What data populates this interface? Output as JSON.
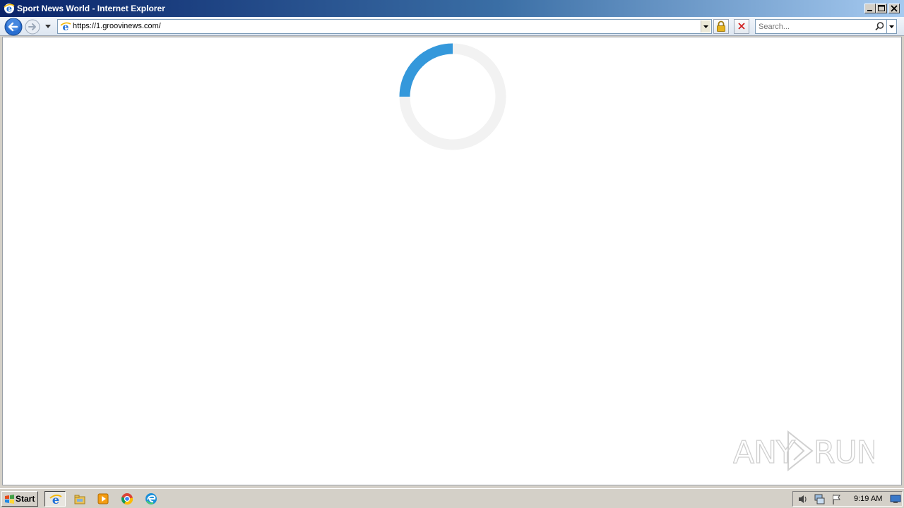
{
  "window": {
    "title": "Sport News World - Internet Explorer",
    "buttons": [
      "minimize",
      "maximize",
      "close"
    ]
  },
  "toolbar": {
    "address_url": "https://1.groovinews.com/",
    "search_placeholder": "Search..."
  },
  "page": {
    "loading_progress": 0.25,
    "accent_color": "#3498db",
    "track_color": "#f2f2f2"
  },
  "watermark": {
    "text": "ANY RUN"
  },
  "taskbar": {
    "start_label": "Start",
    "apps": [
      "internet-explorer",
      "file-explorer",
      "media-player",
      "chrome",
      "edge"
    ],
    "clock": "9:19 AM"
  },
  "icons": [
    "ie-icon",
    "back-arrow-icon",
    "forward-arrow-icon",
    "lock-icon",
    "stop-icon",
    "search-icon",
    "speaker-icon",
    "network-icon",
    "flag-icon",
    "show-desktop-icon"
  ]
}
